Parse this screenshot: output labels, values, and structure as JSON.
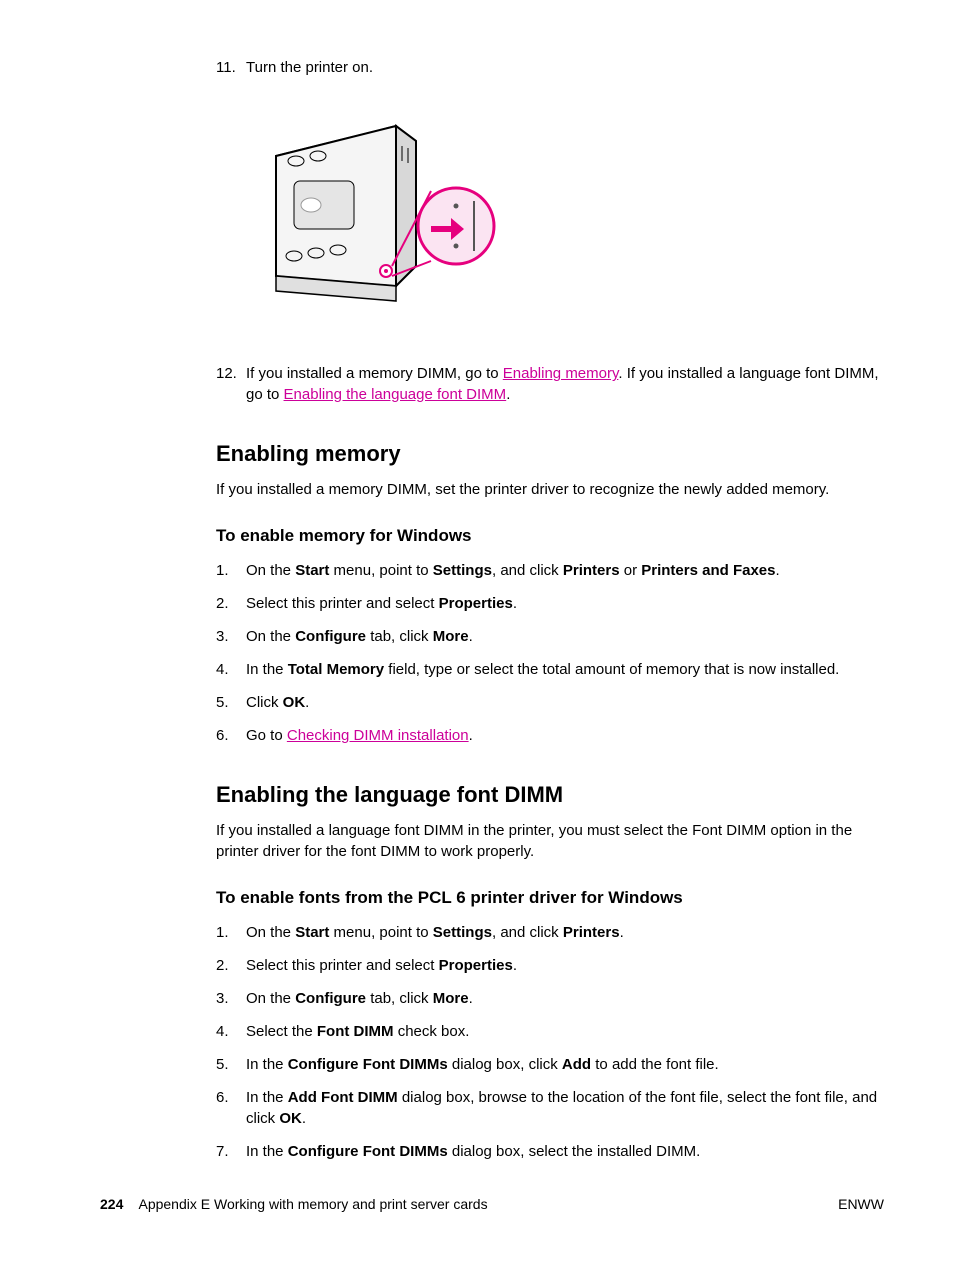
{
  "list": {
    "item11": {
      "num": "11.",
      "text": "Turn the printer on."
    },
    "item12": {
      "num": "12.",
      "pre": "If you installed a memory DIMM, go to ",
      "link1": "Enabling memory",
      "mid": ". If you installed a language font DIMM, go to ",
      "link2": "Enabling the language font DIMM",
      "post": "."
    }
  },
  "sec1": {
    "title": "Enabling memory",
    "intro": "If you installed a memory DIMM, set the printer driver to recognize the newly added memory.",
    "sub": "To enable memory for Windows",
    "steps": {
      "s1": {
        "num": "1.",
        "t1": "On the ",
        "b1": "Start",
        "t2": " menu, point to ",
        "b2": "Settings",
        "t3": ", and click ",
        "b3": "Printers",
        "t4": " or ",
        "b4": "Printers and Faxes",
        "t5": "."
      },
      "s2": {
        "num": "2.",
        "t1": "Select this printer and select ",
        "b1": "Properties",
        "t2": "."
      },
      "s3": {
        "num": "3.",
        "t1": "On the ",
        "b1": "Configure",
        "t2": " tab, click ",
        "b2": "More",
        "t3": "."
      },
      "s4": {
        "num": "4.",
        "t1": "In the ",
        "b1": "Total Memory",
        "t2": " field, type or select the total amount of memory that is now installed."
      },
      "s5": {
        "num": "5.",
        "t1": "Click ",
        "b1": "OK",
        "t2": "."
      },
      "s6": {
        "num": "6.",
        "t1": "Go to ",
        "link": "Checking DIMM installation",
        "t2": "."
      }
    }
  },
  "sec2": {
    "title": "Enabling the language font DIMM",
    "intro": "If you installed a language font DIMM in the printer, you must select the Font DIMM option in the printer driver for the font DIMM to work properly.",
    "sub": "To enable fonts from the PCL 6 printer driver for Windows",
    "steps": {
      "s1": {
        "num": "1.",
        "t1": "On the ",
        "b1": "Start",
        "t2": " menu, point to ",
        "b2": "Settings",
        "t3": ", and click ",
        "b3": "Printers",
        "t5": "."
      },
      "s2": {
        "num": "2.",
        "t1": "Select this printer and select ",
        "b1": "Properties",
        "t2": "."
      },
      "s3": {
        "num": "3.",
        "t1": "On the ",
        "b1": "Configure",
        "t2": " tab, click ",
        "b2": "More",
        "t3": "."
      },
      "s4": {
        "num": "4.",
        "t1": "Select the ",
        "b1": "Font DIMM",
        "t2": " check box."
      },
      "s5": {
        "num": "5.",
        "t1": "In the ",
        "b1": "Configure Font DIMMs",
        "t2": " dialog box, click ",
        "b2": "Add",
        "t3": " to add the font file."
      },
      "s6": {
        "num": "6.",
        "t1": "In the ",
        "b1": "Add Font DIMM",
        "t2": " dialog box, browse to the location of the font file, select the font file, and click ",
        "b2": "OK",
        "t3": "."
      },
      "s7": {
        "num": "7.",
        "t1": "In the ",
        "b1": "Configure Font DIMMs",
        "t2": " dialog box, select the installed DIMM."
      }
    }
  },
  "footer": {
    "pagenum": "224",
    "chapter": "Appendix E   Working with memory and print server cards",
    "right": "ENWW"
  }
}
